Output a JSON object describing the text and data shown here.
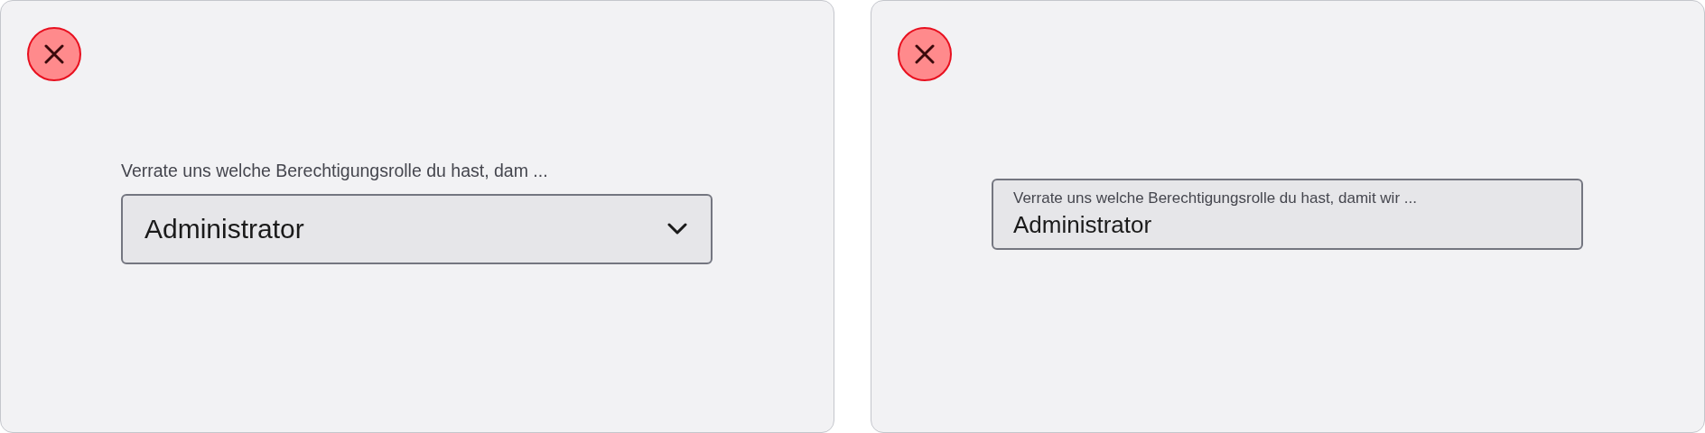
{
  "panels": [
    {
      "kind": "select",
      "label": "Verrate uns welche Berechtigungsrolle du hast, dam ...",
      "value": "Administrator"
    },
    {
      "kind": "floating",
      "label": "Verrate uns welche Berechtigungsrolle du hast, damit wir ...",
      "value": "Administrator"
    }
  ]
}
